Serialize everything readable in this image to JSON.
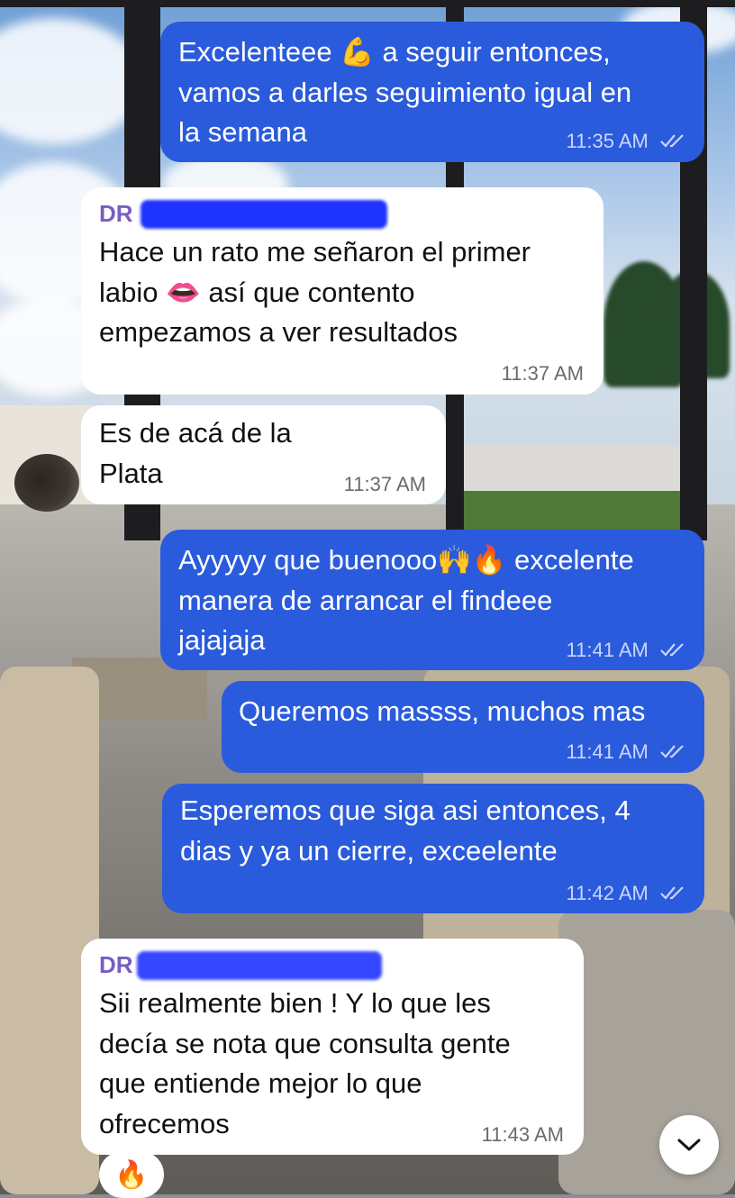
{
  "messages": [
    {
      "direction": "outgoing",
      "text": "Excelenteee 💪 a seguir entonces,\nvamos a darles seguimiento igual en\nla semana",
      "time": "11:35 AM",
      "status": "read"
    },
    {
      "direction": "incoming",
      "sender": "DR",
      "text": "Hace un rato me señaron el primer\nlabio 👄 así que contento\nempezamos a ver resultados",
      "time": "11:37 AM"
    },
    {
      "direction": "incoming",
      "text": "Es de acá de la\nPlata",
      "time": "11:37 AM"
    },
    {
      "direction": "outgoing",
      "text": "Ayyyyy que buenooo🙌🔥 excelente\nmanera de arrancar el findeee\njajajaja",
      "time": "11:41 AM",
      "status": "read"
    },
    {
      "direction": "outgoing",
      "text": "Queremos massss, muchos mas",
      "time": "11:41 AM",
      "status": "read"
    },
    {
      "direction": "outgoing",
      "text": "Esperemos que siga asi entonces, 4\ndias y ya un cierre, exceelente",
      "time": "11:42 AM",
      "status": "read"
    },
    {
      "direction": "incoming",
      "sender": "DR",
      "text": "Sii realmente bien ! Y lo que les\ndecía se nota que consulta gente\nque entiende mejor lo que\nofrecemos",
      "time": "11:43 AM",
      "reaction": "🔥"
    }
  ],
  "icons": {
    "read_receipt": "double-check-icon",
    "scroll_down": "chevron-down-icon"
  },
  "colors": {
    "outgoing_bubble": "#2a5bdc",
    "incoming_bubble": "#ffffff",
    "sender_name": "#7a5cc4",
    "redaction": "#1f33ff"
  }
}
